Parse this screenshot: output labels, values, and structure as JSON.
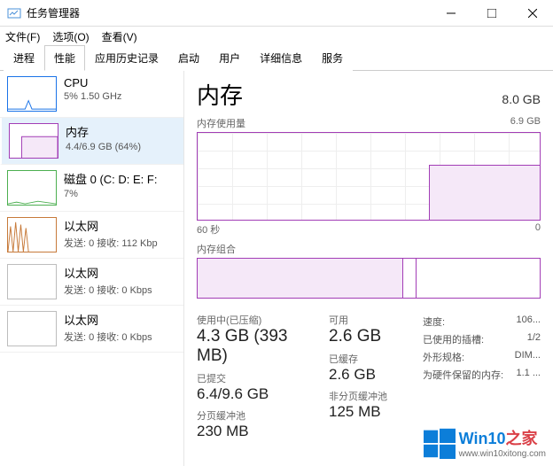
{
  "window": {
    "title": "任务管理器"
  },
  "menu": {
    "file": "文件(F)",
    "options": "选项(O)",
    "view": "查看(V)"
  },
  "tabs": [
    "进程",
    "性能",
    "应用历史记录",
    "启动",
    "用户",
    "详细信息",
    "服务"
  ],
  "sidebar": {
    "cpu": {
      "name": "CPU",
      "detail": "5% 1.50 GHz"
    },
    "memory": {
      "name": "内存",
      "detail": "4.4/6.9 GB (64%)"
    },
    "disk": {
      "name": "磁盘 0 (C: D: E: F:",
      "detail": "7%"
    },
    "net1": {
      "name": "以太网",
      "detail": "发送: 0 接收: 112 Kbp"
    },
    "net2": {
      "name": "以太网",
      "detail": "发送: 0 接收: 0 Kbps"
    },
    "net3": {
      "name": "以太网",
      "detail": "发送: 0 接收: 0 Kbps"
    }
  },
  "main": {
    "title": "内存",
    "total": "8.0 GB",
    "usage_label": "内存使用量",
    "usage_max": "6.9 GB",
    "axis_left": "60 秒",
    "axis_right": "0",
    "comp_label": "内存组合",
    "stats": {
      "in_use_label": "使用中(已压缩)",
      "in_use": "4.3 GB (393 MB)",
      "avail_label": "可用",
      "avail": "2.6 GB",
      "committed_label": "已提交",
      "committed": "6.4/9.6 GB",
      "cached_label": "已缓存",
      "cached": "2.6 GB",
      "paged_label": "分页缓冲池",
      "paged": "230 MB",
      "nonpaged_label": "非分页缓冲池",
      "nonpaged": "125 MB"
    },
    "kv": {
      "speed_k": "速度:",
      "speed_v": "106...",
      "slots_k": "已使用的插槽:",
      "slots_v": "1/2",
      "form_k": "外形规格:",
      "form_v": "DIM...",
      "hw_k": "为硬件保留的内存:",
      "hw_v": "1.1 ..."
    }
  },
  "watermark": {
    "brand": "Win10",
    "suffix": "之家",
    "url": "www.win10xitong.com"
  },
  "chart_data": {
    "type": "line",
    "title": "内存使用量",
    "xlabel": "60 秒",
    "ylabel": "",
    "ylim": [
      0,
      6.9
    ],
    "x_seconds_ago": [
      60,
      55,
      50,
      45,
      40,
      35,
      30,
      25,
      20,
      19,
      18,
      15,
      10,
      5,
      0
    ],
    "values_gb": [
      0,
      0,
      0,
      0,
      0,
      0,
      0,
      0,
      0,
      1.5,
      4.3,
      4.3,
      4.3,
      4.3,
      4.3
    ]
  }
}
